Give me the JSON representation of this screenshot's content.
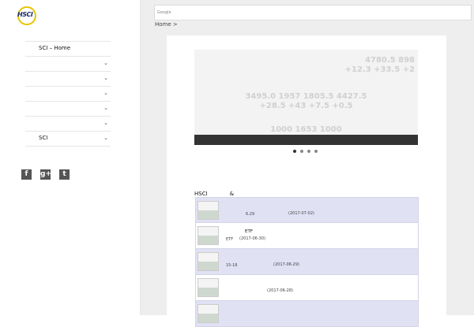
{
  "logo": {
    "text": "HSCI"
  },
  "nav": [
    {
      "label": "　　SCI – Home",
      "chevron": false
    },
    {
      "label": "　　　",
      "chevron": true
    },
    {
      "label": "　　　　　　　　",
      "chevron": true
    },
    {
      "label": "　　　　　　　　",
      "chevron": true
    },
    {
      "label": "　　　",
      "chevron": true
    },
    {
      "label": "　　　　　　　　",
      "chevron": true
    },
    {
      "label": "　　SCI　　　　",
      "chevron": true
    }
  ],
  "social": [
    {
      "icon": "facebook-icon",
      "glyph": "f"
    },
    {
      "icon": "google-plus-icon",
      "glyph": "g+"
    },
    {
      "icon": "tumblr-icon",
      "glyph": "t"
    }
  ],
  "search": {
    "google_label": "Google",
    "placeholder": "　　　　　　"
  },
  "breadcrumb": "Home >",
  "slider": {
    "ticker_rows": [
      "4780.5   898",
      "+12.3   +33.5   +2",
      "3495.0   1957   1805.5   4427.5",
      "+28.5   +43   +7.5   +0.5",
      "1000   1653   1000"
    ],
    "caption": "　　　　　"
  },
  "section_title": "HSCI　　　　&　　　",
  "posts": [
    {
      "title": "　　　　　　　　　　　　　　　　　　　　　　　　　",
      "meta": "　　　　　　6.29",
      "date": "(2017-07-02)",
      "alt": true
    },
    {
      "title": "　　　　　　ETF　　　　　　　　　　　　",
      "meta": "　ETF",
      "date": "(2017-06-30)",
      "alt": false
    },
    {
      "title": "　　　　　　　　　　　　　　　　　　　　　　　　　　　",
      "meta": "　15-16",
      "date": "(2017-06-29)",
      "alt": true
    },
    {
      "title": "　　　　　　　　　　",
      "meta": "",
      "date": "(2017-06-28)",
      "alt": false
    },
    {
      "title": "　　　　　　　　　　　　　　　　　　　　　　　　",
      "meta": "",
      "date": "",
      "alt": true
    }
  ]
}
